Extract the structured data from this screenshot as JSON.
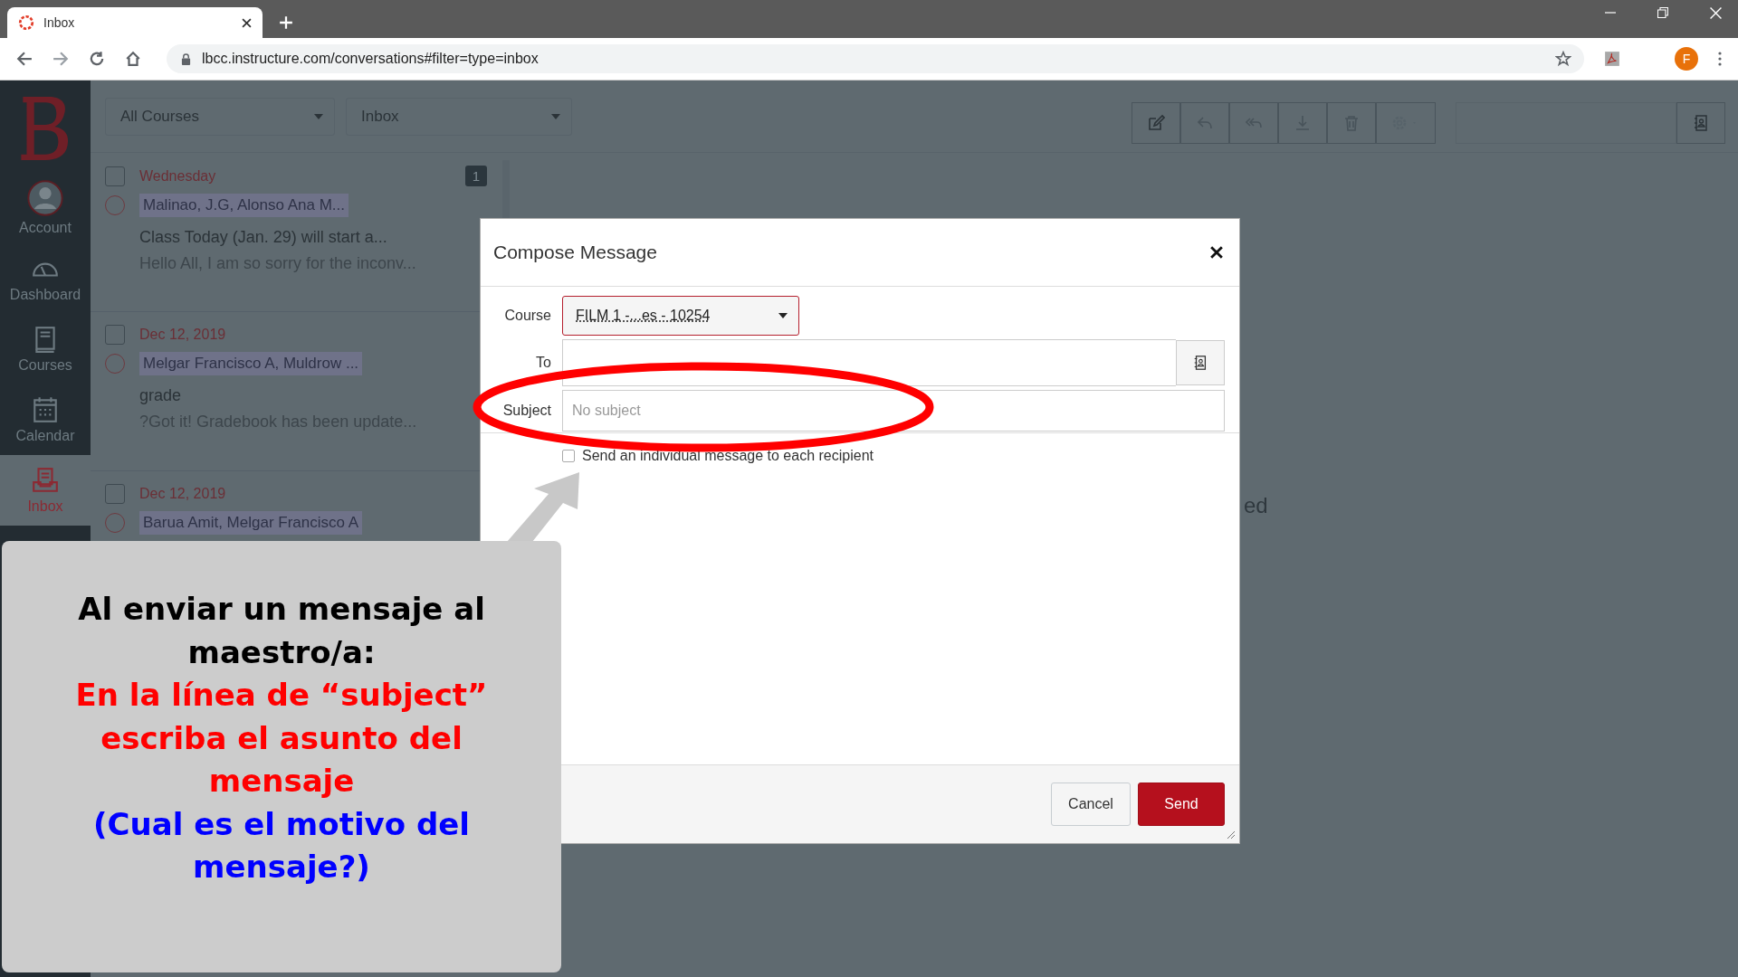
{
  "browser": {
    "tab_title": "Inbox",
    "url": "lbcc.instructure.com/conversations#filter=type=inbox",
    "profile_initial": "F"
  },
  "sidebar": {
    "items": [
      {
        "label": "Account",
        "selected": false
      },
      {
        "label": "Dashboard",
        "selected": false
      },
      {
        "label": "Courses",
        "selected": false
      },
      {
        "label": "Calendar",
        "selected": false
      },
      {
        "label": "Inbox",
        "selected": true
      }
    ]
  },
  "toolbar": {
    "course_filter": "All Courses",
    "mailbox_filter": "Inbox"
  },
  "conversations": [
    {
      "checked": false,
      "date": "Wednesday",
      "count": "1",
      "participants": "Malinao, J.G, Alonso Ana M...",
      "subject": "Class Today (Jan. 29) will start a...",
      "preview": "Hello All, I am so sorry for the inconv..."
    },
    {
      "checked": false,
      "date": "Dec 12, 2019",
      "participants": "Melgar Francisco A, Muldrow ...",
      "subject": "grade",
      "preview": "?Got it! Gradebook has been update..."
    },
    {
      "checked": false,
      "date": "Dec 12, 2019",
      "participants": "Barua Amit, Melgar Francisco A"
    }
  ],
  "right_pane_text": "ed",
  "dialog": {
    "title": "Compose Message",
    "course_label": "Course",
    "course_value": "FILM 1 -...es - 10254",
    "to_label": "To",
    "subject_label": "Subject",
    "subject_placeholder": "No subject",
    "individual_label": "Send an individual message to each recipient",
    "individual_checked": false,
    "cancel": "Cancel",
    "send": "Send"
  },
  "annotation": {
    "paragraphs": [
      {
        "text": "Al enviar un mensaje al maestro/a:",
        "color": "#000000"
      },
      {
        "text": "En la línea de “subject” escriba el asunto del mensaje",
        "color": "#ff0000"
      },
      {
        "text": "(Cual es el motivo del mensaje?)",
        "color": "#0000ff"
      }
    ]
  }
}
